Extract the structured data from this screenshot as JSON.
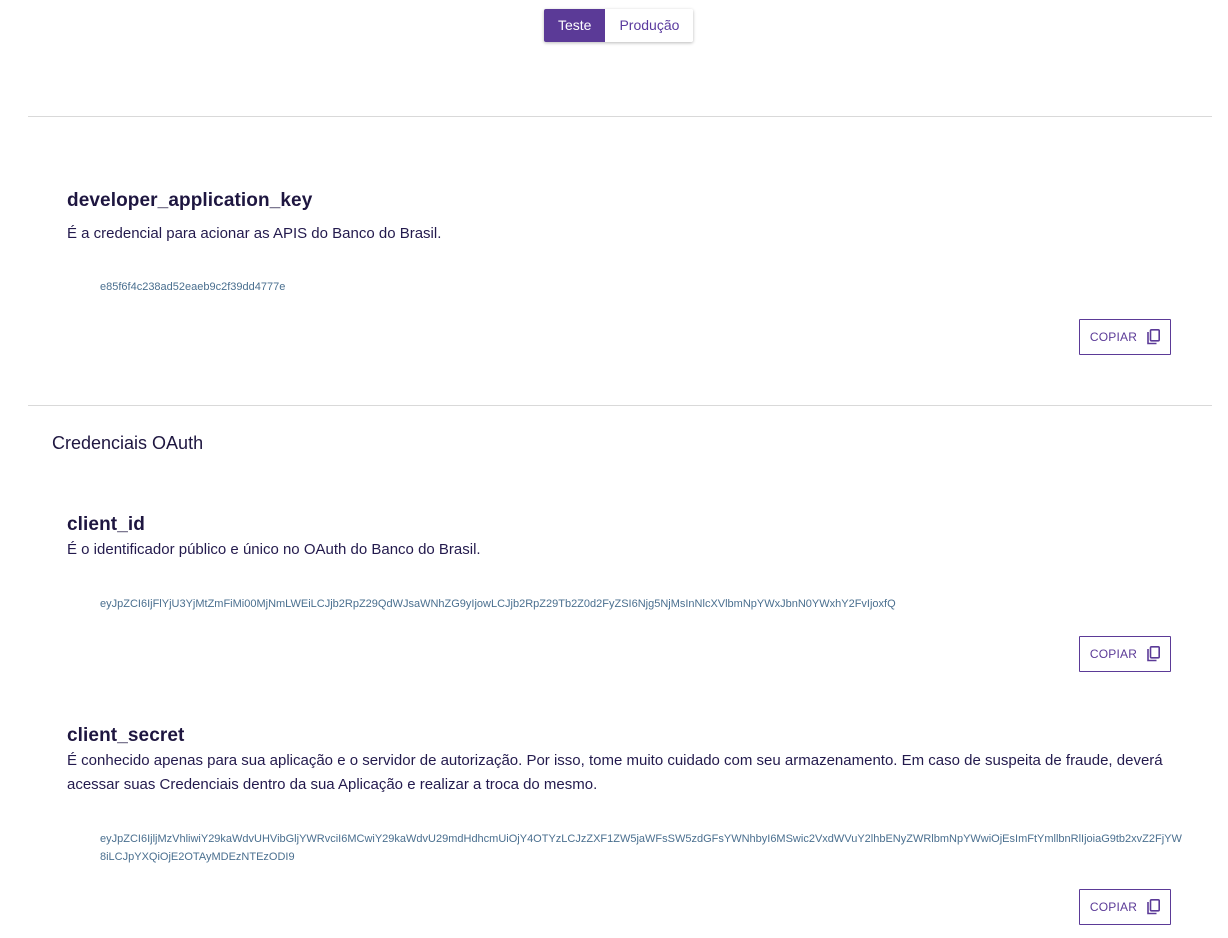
{
  "env_toggle": {
    "options": [
      "Teste",
      "Produção"
    ],
    "selected": "Teste"
  },
  "app_key": {
    "title": "developer_application_key",
    "description": "É a credencial para acionar as APIS do Banco do Brasil.",
    "value": "e85f6f4c238ad52eaeb9c2f39dd4777e",
    "copy_label": "COPIAR"
  },
  "oauth": {
    "heading": "Credenciais OAuth",
    "client_id": {
      "title": "client_id",
      "description": "É o identificador público e único no OAuth do Banco do Brasil.",
      "value": "eyJpZCI6IjFlYjU3YjMtZmFiMi00MjNmLWEiLCJjb2RpZ29QdWJsaWNhZG9yIjowLCJjb2RpZ29Tb2Z0d2FyZSI6Njg5NjMsInNlcXVlbmNpYWxJbnN0YWxhY2FvIjoxfQ",
      "copy_label": "COPIAR"
    },
    "client_secret": {
      "title": "client_secret",
      "description": "É conhecido apenas para sua aplicação e o servidor de autorização. Por isso, tome muito cuidado com seu armazenamento. Em caso de suspeita de fraude, deverá acessar suas Credenciais dentro da sua Aplicação e realizar a troca do mesmo.",
      "value": "eyJpZCI6IjljMzVhliwiY29kaWdvUHVibGljYWRvciI6MCwiY29kaWdvU29mdHdhcmUiOjY4OTYzLCJzZXF1ZW5jaWFsSW5zdGFsYWNhbyI6MSwic2VxdWVuY2lhbENyZWRlbmNpYWwiOjEsImFtYmllbnRlIjoiaG9tb2xvZ2FjYW8iLCJpYXQiOjE2OTAyMDEzNTEzODI9",
      "copy_label": "COPIAR"
    }
  },
  "icons": {
    "copy": "copy-icon"
  },
  "colors": {
    "accent": "#5b3a97",
    "text": "#1e1640",
    "value": "#4a6f8f"
  }
}
